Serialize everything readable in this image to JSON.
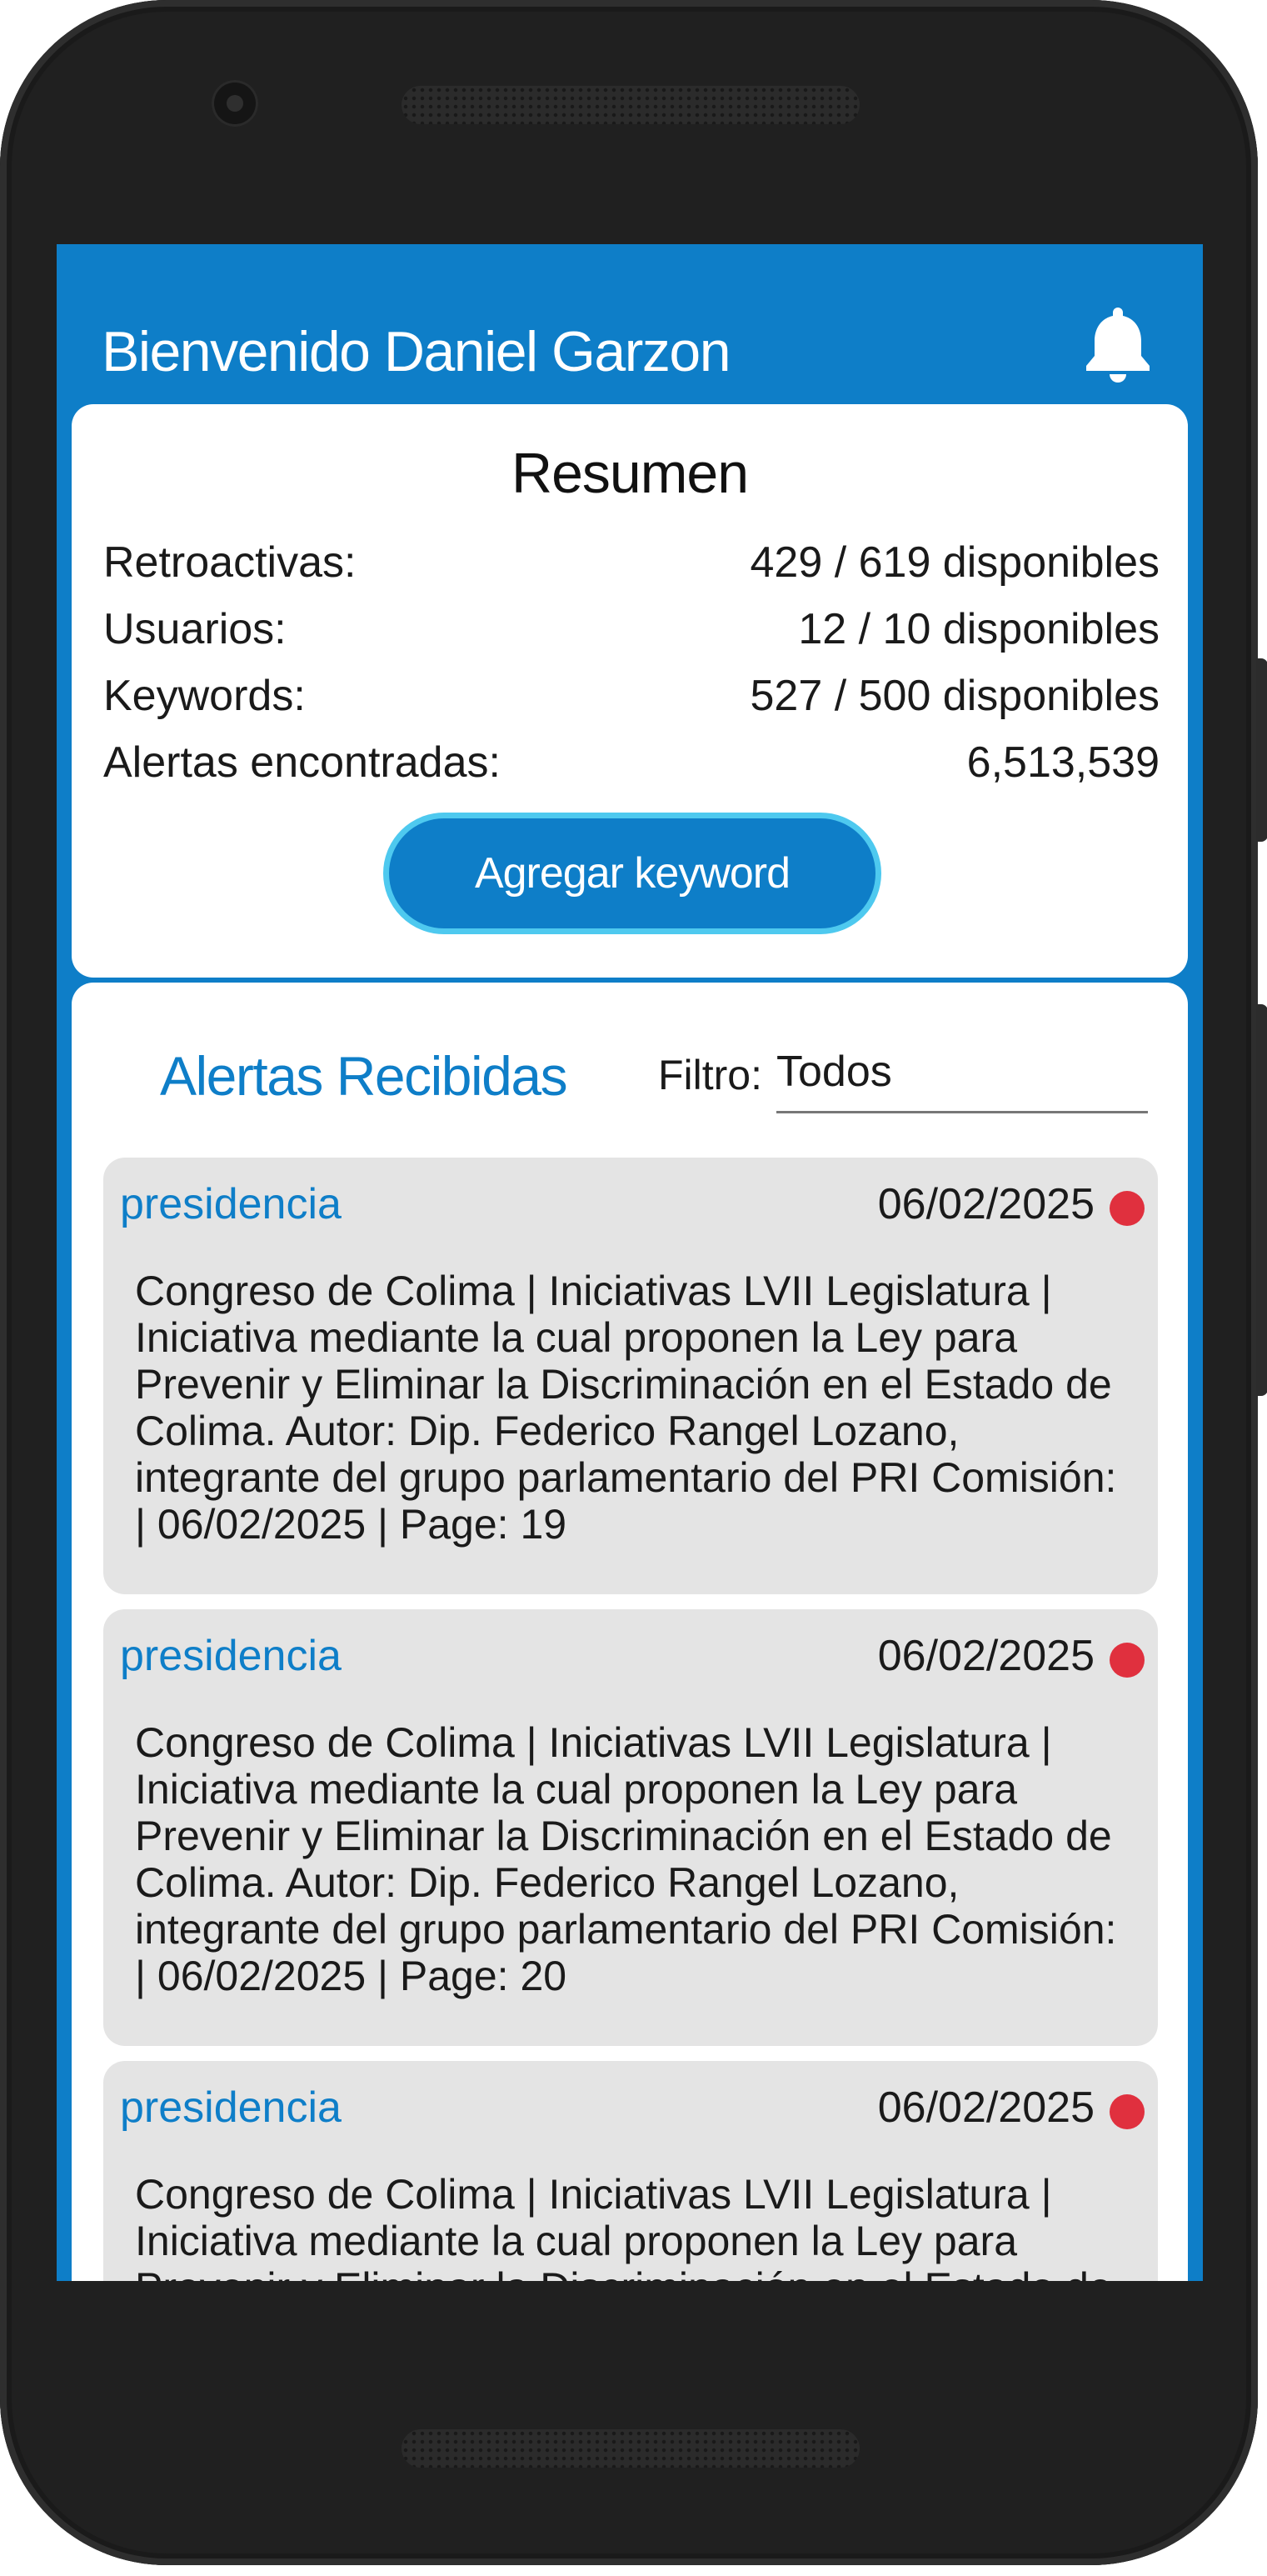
{
  "header": {
    "welcome": "Bienvenido Daniel Garzon",
    "bell_icon": "bell-icon"
  },
  "summary": {
    "title": "Resumen",
    "rows": [
      {
        "label": "Retroactivas:",
        "value": "429 / 619 disponibles"
      },
      {
        "label": "Usuarios:",
        "value": "12 / 10 disponibles"
      },
      {
        "label": "Keywords:",
        "value": "527 / 500 disponibles"
      },
      {
        "label": "Alertas encontradas:",
        "value": "6,513,539"
      }
    ],
    "add_button": "Agregar keyword"
  },
  "alerts": {
    "title": "Alertas Recibidas",
    "filter_label": "Filtro:",
    "filter_value": "Todos",
    "items": [
      {
        "keyword": "presidencia",
        "date": "06/02/2025",
        "text": "Congreso de Colima | Iniciativas LVII Legislatura | Iniciativa mediante la cual proponen la Ley para Prevenir y Eliminar la Discriminación en el Estado de Colima. Autor: Dip. Federico Rangel Lozano, integrante del grupo parlamentario del PRI Comisión: | 06/02/2025 | Page: 19"
      },
      {
        "keyword": "presidencia",
        "date": "06/02/2025",
        "text": "Congreso de Colima | Iniciativas LVII Legislatura | Iniciativa mediante la cual proponen la Ley para Prevenir y Eliminar la Discriminación en el Estado de Colima. Autor: Dip. Federico Rangel Lozano, integrante del grupo parlamentario del PRI Comisión: | 06/02/2025 | Page: 20"
      },
      {
        "keyword": "presidencia",
        "date": "06/02/2025",
        "text": "Congreso de Colima | Iniciativas LVII Legislatura | Iniciativa mediante la cual proponen la Ley para Prevenir y Eliminar la Discriminación en el Estado de Colima."
      }
    ]
  },
  "colors": {
    "primary": "#0e7ec8",
    "button_border": "#4ec9ef",
    "unread_dot": "#e0303e",
    "card_bg": "#e4e4e4",
    "phone_frame": "#202020"
  }
}
